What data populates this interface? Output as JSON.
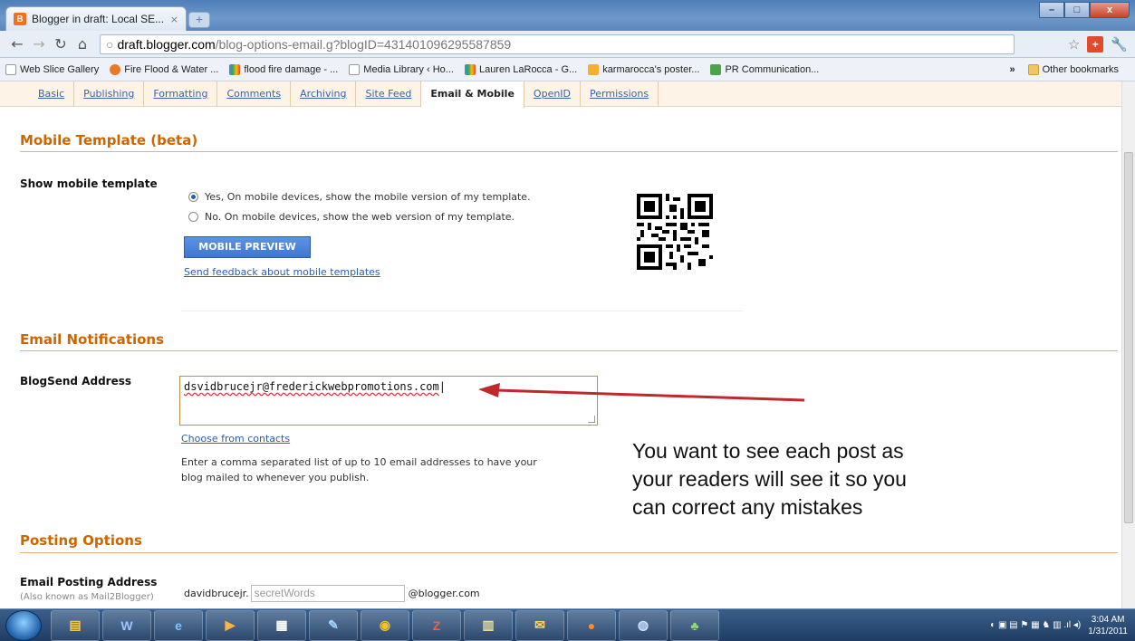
{
  "browser": {
    "tab_title": "Blogger in draft: Local SE...",
    "tab_close": "×",
    "new_tab": "+",
    "window_buttons": [
      "–",
      "□",
      "x"
    ],
    "url_host": "draft.blogger.com",
    "url_path": "/blog-options-email.g?blogID=431401096295587859"
  },
  "bookmarks": {
    "items": [
      "Web Slice Gallery",
      "Fire Flood & Water ...",
      "flood fire damage - ...",
      "Media Library ‹ Ho...",
      "Lauren LaRocca - G...",
      "karmarocca's poster...",
      "PR Communication..."
    ],
    "more": "»",
    "other": "Other bookmarks"
  },
  "settings_tabs": [
    {
      "label": "Basic",
      "active": false
    },
    {
      "label": "Publishing",
      "active": false
    },
    {
      "label": "Formatting",
      "active": false
    },
    {
      "label": "Comments",
      "active": false
    },
    {
      "label": "Archiving",
      "active": false
    },
    {
      "label": "Site Feed",
      "active": false
    },
    {
      "label": "Email & Mobile",
      "active": true
    },
    {
      "label": "OpenID",
      "active": false
    },
    {
      "label": "Permissions",
      "active": false
    }
  ],
  "mobile": {
    "heading": "Mobile Template (beta)",
    "label": "Show mobile template",
    "option_yes": "Yes, On mobile devices, show the mobile version of my template.",
    "option_no": "No. On mobile devices, show the web version of my template.",
    "selected": "yes",
    "preview_button": "MOBILE PREVIEW",
    "feedback_link": "Send feedback about mobile templates"
  },
  "email": {
    "heading": "Email Notifications",
    "label": "BlogSend Address",
    "value": "dsvidbrucejr@frederickwebpromotions.com",
    "choose_link": "Choose from contacts",
    "help": "Enter a comma separated list of up to 10 email addresses to have your blog mailed to whenever you publish."
  },
  "annotation": {
    "lines": [
      "You want to see each post as",
      "your readers will see it so you",
      "can correct any mistakes"
    ],
    "arrow_color": "#c0282d"
  },
  "posting": {
    "heading": "Posting Options",
    "label": "Email Posting Address",
    "sublabel": "(Also known as Mail2Blogger)",
    "prefix": "davidbrucejr.",
    "placeholder": "secretWords",
    "suffix": "@blogger.com"
  },
  "taskbar": {
    "apps": [
      "files",
      "word",
      "ie",
      "media",
      "panel",
      "notes",
      "chrome",
      "filezilla",
      "clipboard",
      "outlook",
      "firefox",
      "network",
      "messenger"
    ],
    "time": "3:04 AM",
    "date": "1/31/2011"
  },
  "colors": {
    "accent": "#cc6600",
    "link": "#2a5db0",
    "button": "#3f76cf"
  }
}
